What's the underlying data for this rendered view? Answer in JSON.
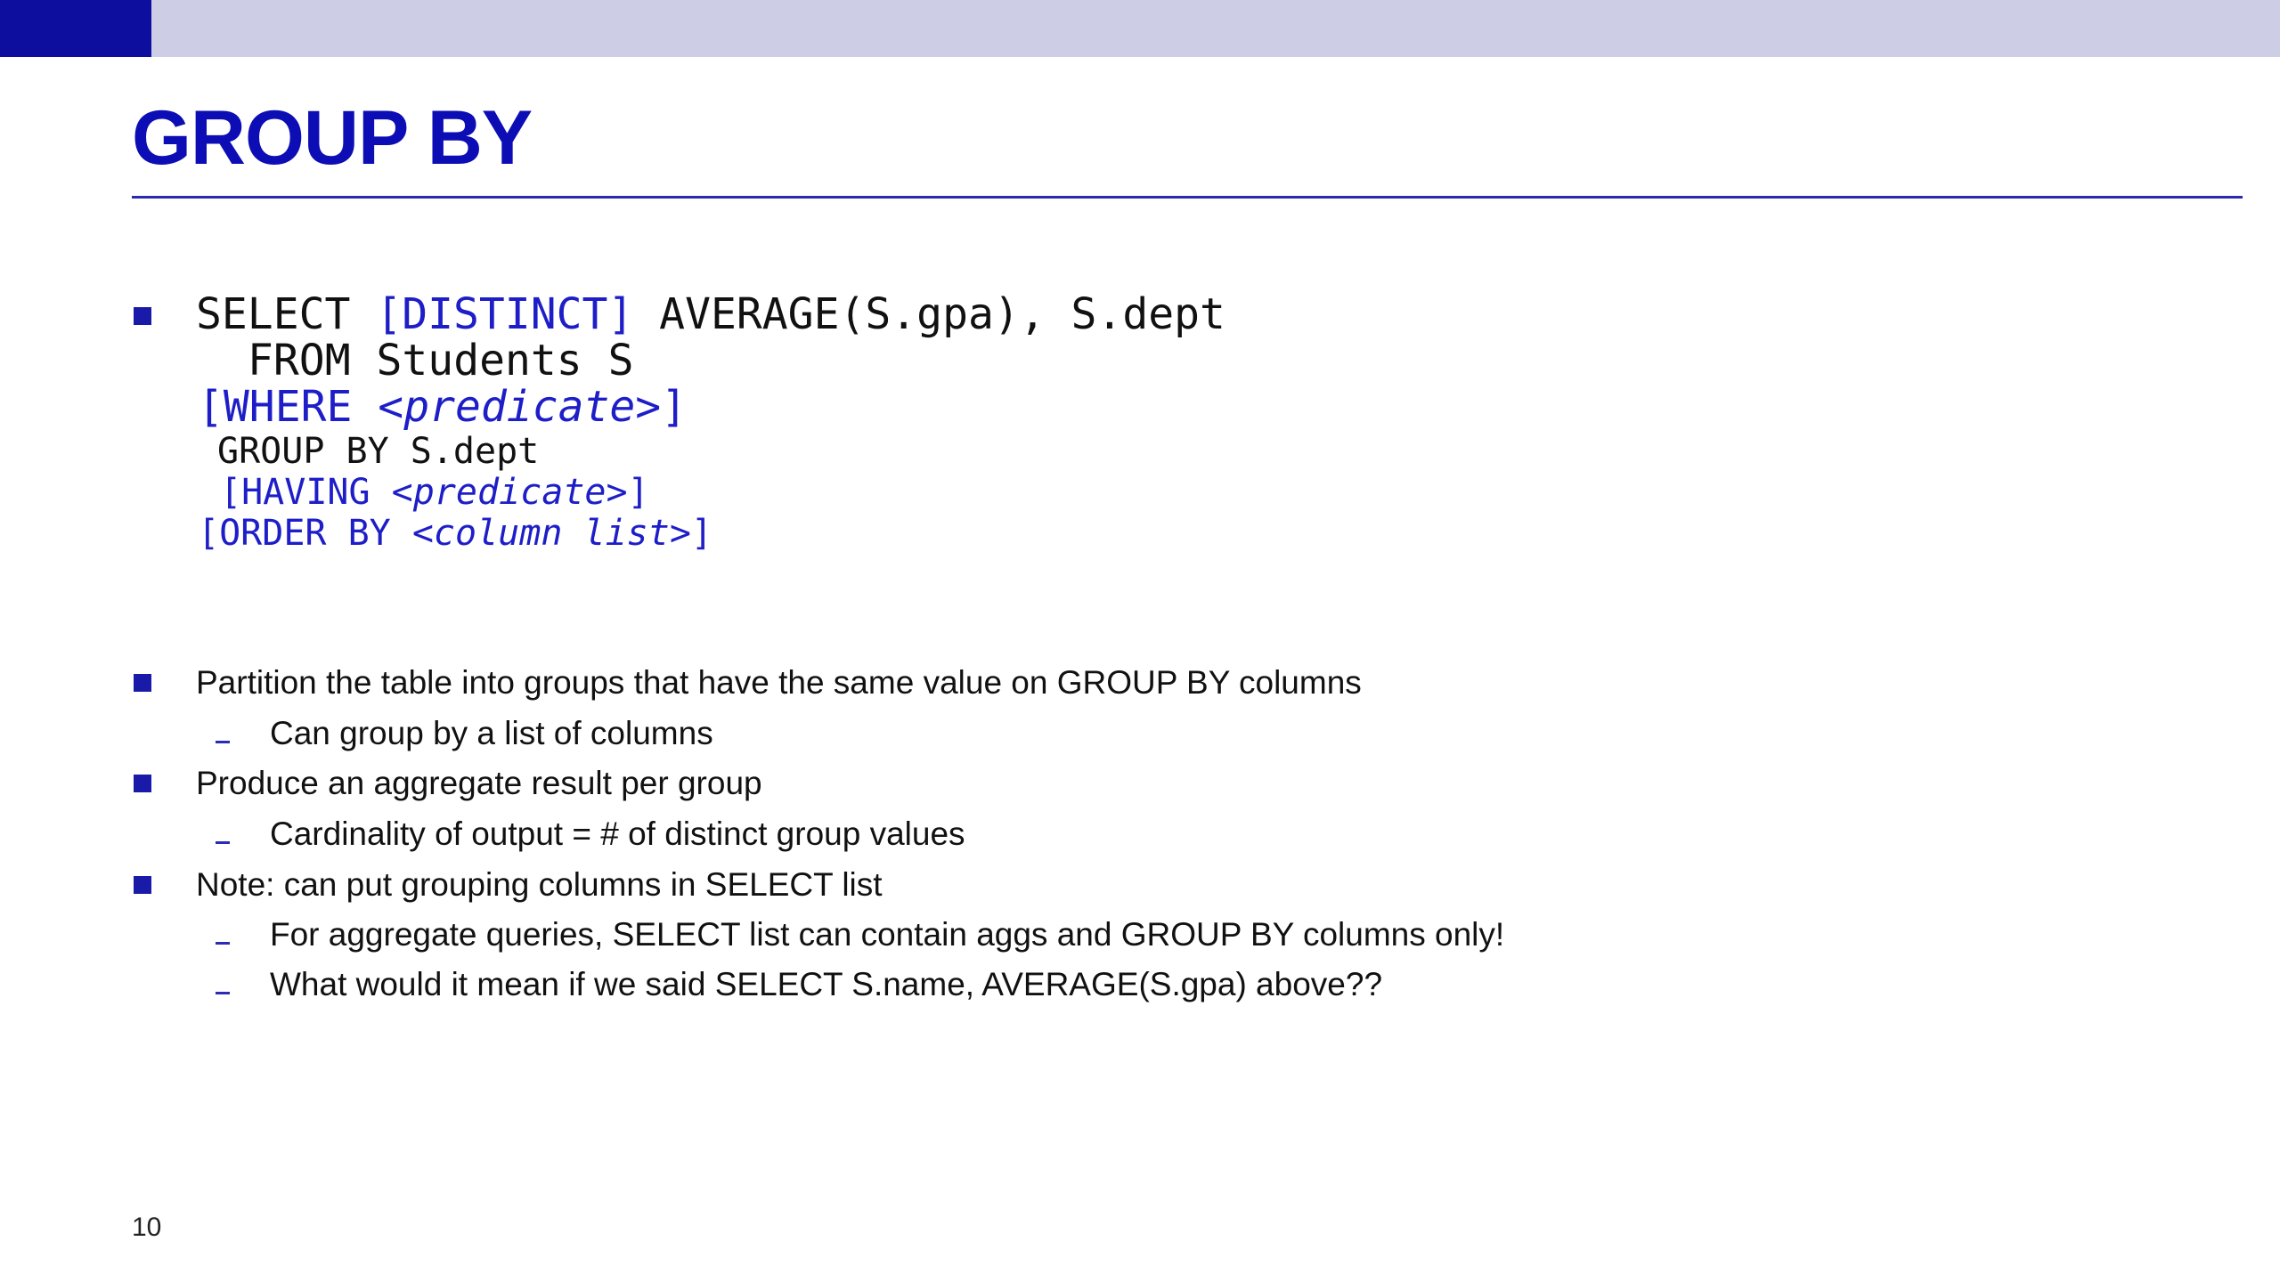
{
  "slide": {
    "title": "GROUP BY",
    "page_number": "10",
    "accent_color": "#0d0d9e",
    "title_color": "#0d0db5",
    "topbar_color": "#cdcde6"
  },
  "query": {
    "l1_select": "SELECT ",
    "l1_distinct": "[DISTINCT]",
    "l1_rest": " AVERAGE(S.gpa), S.dept",
    "l2": "FROM Students S",
    "l3_open": "[WHERE ",
    "l3_pred": "<predicate>",
    "l3_close": "]",
    "l4": "GROUP BY S.dept",
    "l5_open": "[HAVING ",
    "l5_pred": "<predicate>",
    "l5_close": "]",
    "l6_open": "[ORDER BY ",
    "l6_pred": "<column list>",
    "l6_close": "]"
  },
  "bullets": [
    "Partition the table into groups that have the same value on GROUP BY columns",
    "Produce an aggregate result per group",
    "Note: can put grouping columns in SELECT list"
  ],
  "sub_bullets": [
    "Can group by a list of columns",
    "Cardinality of output = # of distinct group values",
    "For aggregate queries, SELECT list can contain aggs and GROUP BY columns only!",
    "What would it mean if we said SELECT S.name, AVERAGE(S.gpa) above??"
  ]
}
